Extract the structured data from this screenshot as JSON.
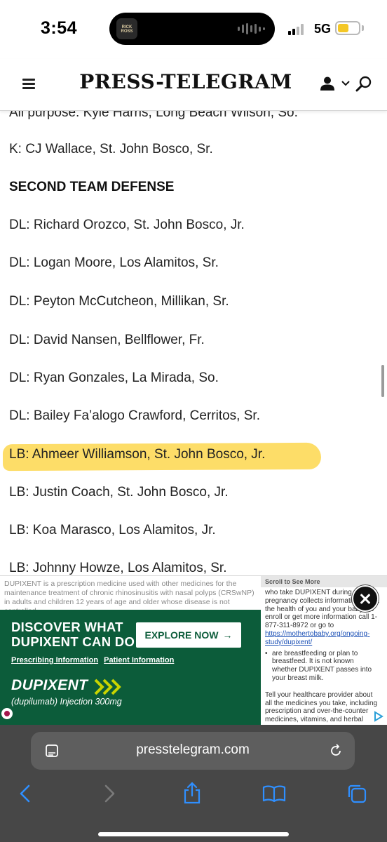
{
  "status_bar": {
    "time": "3:54",
    "now_playing_art_text": "RICK ROSS",
    "network": "5G",
    "battery_level": 0.55,
    "battery_color": "#f4c726"
  },
  "site_header": {
    "masthead": "PRESS-TELEGRAM",
    "icons": [
      "menu-icon",
      "user-icon",
      "chevron-down-icon",
      "search-icon"
    ]
  },
  "article": {
    "lines": [
      {
        "text": "All purpose: Kyle Harris, Long Beach Wilson, So.",
        "heading": false
      },
      {
        "text": "K: CJ Wallace, St. John Bosco, Sr.",
        "heading": false
      },
      {
        "text": "SECOND TEAM DEFENSE",
        "heading": true
      },
      {
        "text": "DL: Richard Orozco, St. John Bosco, Jr.",
        "heading": false
      },
      {
        "text": "DL: Logan Moore, Los Alamitos, Sr.",
        "heading": false
      },
      {
        "text": "DL: Peyton McCutcheon, Millikan, Sr.",
        "heading": false
      },
      {
        "text": "DL: David Nansen, Bellflower, Fr.",
        "heading": false
      },
      {
        "text": "DL: Ryan Gonzales, La Mirada, So.",
        "heading": false
      },
      {
        "text": "DL: Bailey Fa’alogo Crawford, Cerritos, Sr.",
        "heading": false
      },
      {
        "text": "LB: Ahmeer Williamson, St. John Bosco, Jr.",
        "heading": false,
        "highlighted": true
      },
      {
        "text": "LB: Justin Coach, St. John Bosco, Jr.",
        "heading": false
      },
      {
        "text": "LB: Koa Marasco, Los Alamitos, Jr.",
        "heading": false
      },
      {
        "text": "LB: Johnny Howze, Los Alamitos, Sr.",
        "heading": false
      }
    ],
    "highlight_color": "#fcd43e"
  },
  "ad": {
    "isi_left": "DUPIXENT is a prescription medicine used with other medicines for the maintenance treatment of chronic rhinosinusitis with nasal polyps (CRSwNP) in adults and children 12 years of age and older whose disease is not controlled.",
    "isi_left_brand": "DUPIXENT",
    "headline_1": "DISCOVER WHAT",
    "headline_2": "DUPIXENT CAN DO",
    "cta_label": "EXPLORE NOW",
    "cta_arrow": "→",
    "link_prescribing": "Prescribing Information",
    "link_patient": "Patient Information",
    "brand": "DUPIXENT",
    "generic_name": "(dupilumab) Injection 300mg",
    "scroll_label": "Scroll to See More",
    "isi_right_1": "who take DUPIXENT during pregnancy collects information about the health of you and your baby. To enroll or get more information call 1-877-311-8972 or go to",
    "isi_right_url": "https://mothertobaby.org/ongoing-study/dupixent/",
    "isi_right_bullet": "are breastfeeding or plan to breastfeed. It is not known whether DUPIXENT passes into your breast milk.",
    "isi_right_2": "Tell your healthcare provider about all the medicines you take, including prescription and over-the-counter medicines, vitamins, and herbal",
    "brand_green": "#0c5c3a",
    "accent_yellow": "#c8d400"
  },
  "browser": {
    "url": "presstelegram.com",
    "toolbar_icons": [
      "back-icon",
      "forward-icon",
      "share-icon",
      "bookmarks-icon",
      "tabs-icon"
    ],
    "accent": "#2f8fff"
  }
}
